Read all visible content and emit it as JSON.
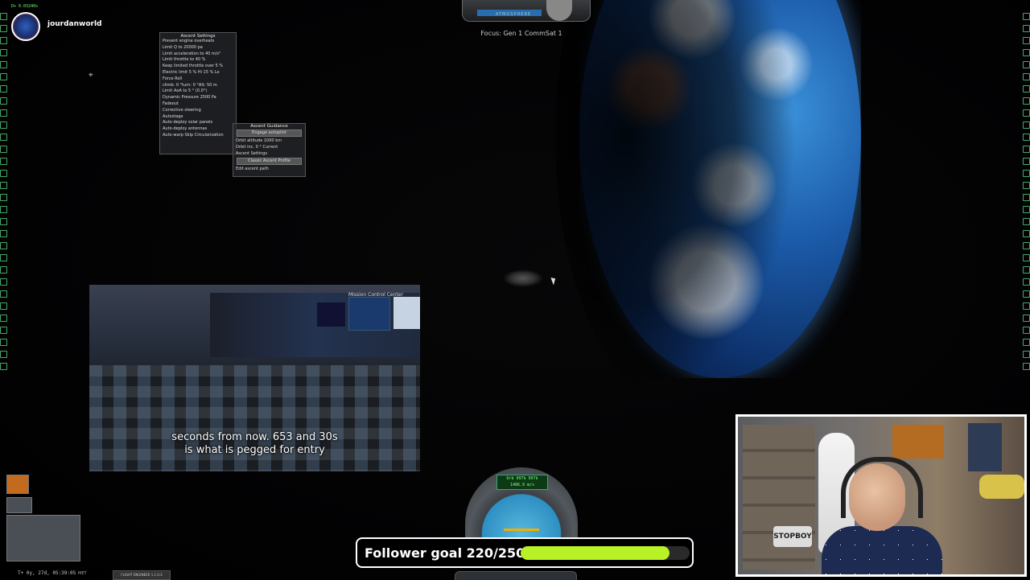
{
  "streamer": {
    "username": "jourdanworld",
    "dv_readout": "D+ 0.03240s"
  },
  "hud": {
    "focus_label": "Focus: Gen 1 CommSat 1",
    "atmosphere_label": "ATMOSPHERE",
    "orbital_readout": "Orb 997k 997k",
    "speed_readout": "1486.9 m/s",
    "met_label": "T+ 0y, 27d, 05:39:05",
    "met_tag": "MET",
    "flight_engineer": "FLIGHT ENGINEER 1.1.0.3"
  },
  "ascent_settings": {
    "title": "Ascent Settings",
    "rows": [
      "Prevent engine overheats",
      "Limit Q to   20000  pa",
      "Limit acceleration to  40  m/s²",
      "Limit throttle to   40  %",
      "Keep limited throttle over  5  %",
      "Electric limit  5  % Hi 15  %  Lo",
      "Force Roll",
      "climb: 0  °turn: 0  °Alt: 50  m",
      "Limit AoA to  5  ° (0.0°)",
      "Dynamic Pressure  2500  Pa",
      "Fadeout",
      "Corrective steering",
      "Autostage",
      "Auto-deploy solar panels",
      "Auto-deploy antennas",
      "Auto-warp   Skip Circularization"
    ]
  },
  "ascent_guidance": {
    "title": "Ascent Guidance",
    "engage_button": "Engage autopilot",
    "orbit_altitude": "Orbit altitude  1000  km",
    "orbit_inc": "Orbit inc.  0  °  Current",
    "settings_toggle": "Ascent Settings",
    "profile_button": "Classic Ascent Profile",
    "edit_path": "Edit ascent path"
  },
  "video_overlay": {
    "logo": "Mission Control Center",
    "caption_line1": "seconds from now. 653 and 30s",
    "caption_line2": "is what is pegged for entry"
  },
  "follower_goal": {
    "label": "Follower goal 220/250",
    "current": 220,
    "target": 250,
    "bar_color": "#b8f226"
  },
  "webcam": {
    "sign_text": "STOPBOY"
  },
  "icons": {
    "target": "crosshair-icon",
    "cursor": "mouse-cursor-icon"
  }
}
